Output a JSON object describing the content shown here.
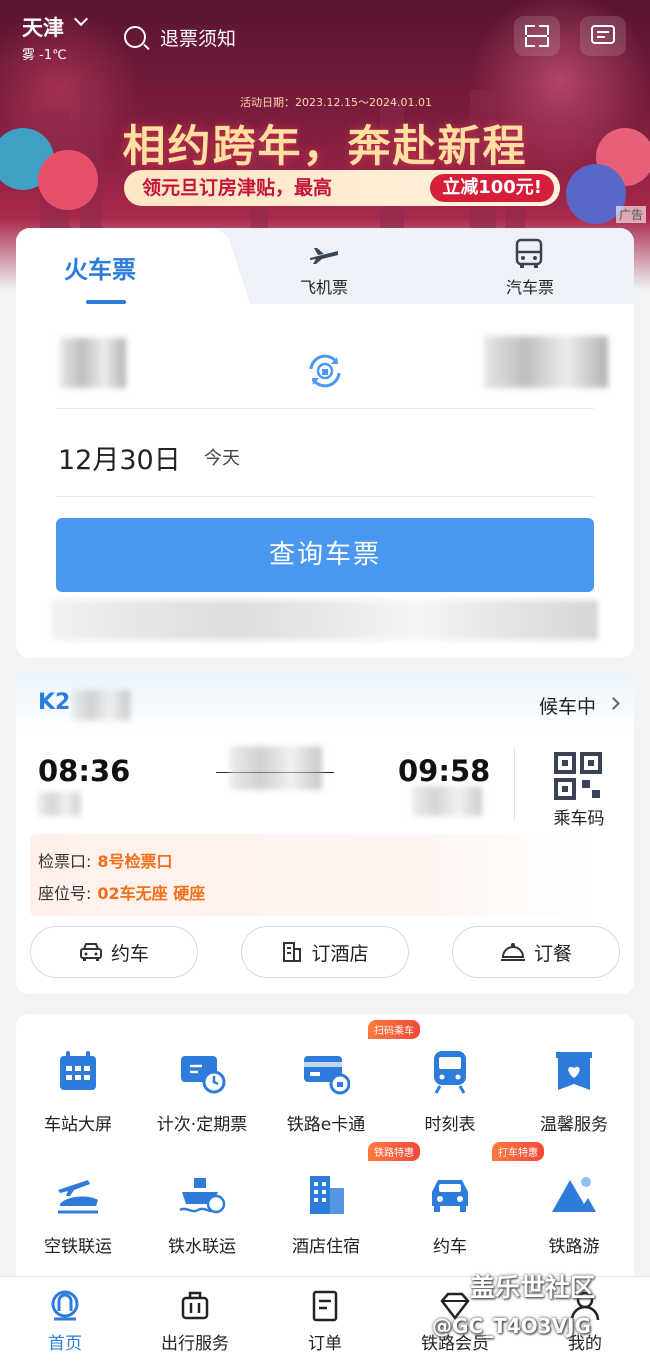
{
  "header": {
    "city": "天津",
    "weather": "雾 -1℃",
    "search_text": "退票须知"
  },
  "banner": {
    "date": "活动日期：2023.12.15～2024.01.01",
    "headline": "相约跨年，奔赴新程",
    "promo": "领元旦订房津贴，最高",
    "promo_highlight": "立减100元!",
    "ad_tag": "广告"
  },
  "booking": {
    "tabs": [
      "火车票",
      "飞机票",
      "汽车票"
    ],
    "date": "12月30日",
    "today": "今天",
    "query_button": "查询车票"
  },
  "trip": {
    "train_no": "K2",
    "status": "候车中",
    "depart_time": "08:36",
    "arrive_time": "09:58",
    "qr_label": "乘车码",
    "gate_label": "检票口:",
    "gate_value": "8号检票口",
    "seat_label": "座位号:",
    "seat_value": "02车无座 硬座",
    "actions": [
      "约车",
      "订酒店",
      "订餐"
    ]
  },
  "services": [
    {
      "label": "车站大屏",
      "icon": "calendar-grid-icon"
    },
    {
      "label": "计次·定期票",
      "icon": "ticket-clock-icon"
    },
    {
      "label": "铁路e卡通",
      "icon": "card-icon",
      "badge": "扫码乘车"
    },
    {
      "label": "时刻表",
      "icon": "train-icon"
    },
    {
      "label": "温馨服务",
      "icon": "heart-box-icon"
    },
    {
      "label": "空铁联运",
      "icon": "plane-train-icon"
    },
    {
      "label": "铁水联运",
      "icon": "ship-icon"
    },
    {
      "label": "酒店住宿",
      "icon": "hotel-icon",
      "badge": "铁路特惠"
    },
    {
      "label": "约车",
      "icon": "car-icon",
      "badge": "打车特惠"
    },
    {
      "label": "铁路游",
      "icon": "mountain-icon"
    }
  ],
  "tabbar": [
    {
      "label": "首页",
      "active": true
    },
    {
      "label": "出行服务"
    },
    {
      "label": "订单"
    },
    {
      "label": "铁路会员"
    },
    {
      "label": "我的"
    }
  ],
  "watermark": {
    "line1": "盖乐世社区",
    "line2": "@GC_T4O3VJG"
  },
  "colors": {
    "accent": "#2d7cdb",
    "button": "#4a98ef",
    "warning": "#f0701a"
  }
}
